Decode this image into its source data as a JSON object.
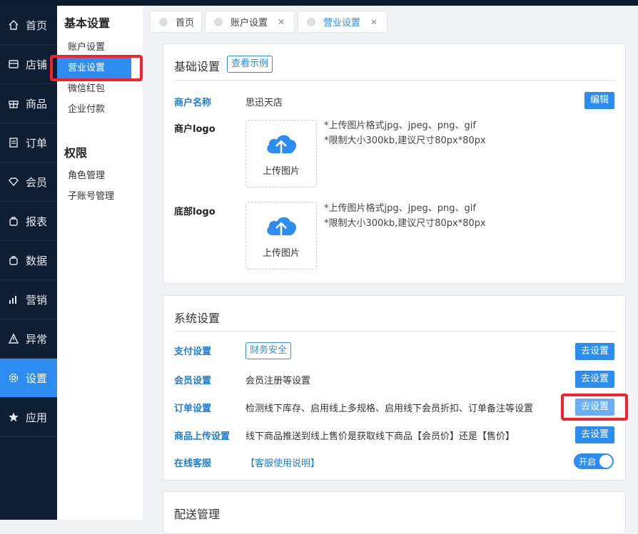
{
  "nav": {
    "items": [
      {
        "label": "首页",
        "icon": "home-icon"
      },
      {
        "label": "店铺",
        "icon": "store-icon"
      },
      {
        "label": "商品",
        "icon": "gift-icon"
      },
      {
        "label": "订单",
        "icon": "order-icon"
      },
      {
        "label": "会员",
        "icon": "diamond-icon"
      },
      {
        "label": "报表",
        "icon": "bag-icon"
      },
      {
        "label": "数据",
        "icon": "bag-icon"
      },
      {
        "label": "营销",
        "icon": "bar-chart-icon"
      },
      {
        "label": "异常",
        "icon": "warning-icon"
      },
      {
        "label": "设置",
        "icon": "gear-icon"
      },
      {
        "label": "应用",
        "icon": "star-icon"
      }
    ],
    "active_index": 9
  },
  "subnav": {
    "group1_title": "基本设置",
    "group1_items": [
      "账户设置",
      "营业设置",
      "微信红包",
      "企业付款"
    ],
    "group2_title": "权限",
    "group2_items": [
      "角色管理",
      "子账号管理"
    ],
    "active_item": "营业设置"
  },
  "tabs": [
    {
      "label": "首页"
    },
    {
      "label": "账户设置",
      "close": "✕"
    },
    {
      "label": "营业设置",
      "close": "✕"
    }
  ],
  "basic": {
    "title": "基础设置",
    "example_link": "查看示例",
    "merchant_name_label": "商户名称",
    "merchant_name_value": "思迅天店",
    "edit_button": "编辑",
    "logo_label": "商户logo",
    "bottom_logo_label": "底部logo",
    "upload_text": "上传图片",
    "hint_line1": "*上传图片格式jpg、jpeg、png、gif",
    "hint_line2": "*限制大小300kb,建议尺寸80px*80px"
  },
  "system": {
    "title": "系统设置",
    "rows": [
      {
        "label": "支付设置",
        "value": "财务安全",
        "button": "去设置"
      },
      {
        "label": "会员设置",
        "value": "会员注册等设置",
        "button": "去设置"
      },
      {
        "label": "订单设置",
        "value": "检测线下库存、启用线上多规格、启用线下会员折扣、订单备注等设置",
        "button": "去设置"
      },
      {
        "label": "商品上传设置",
        "value": "线下商品推送到线上售价是获取线下商品【会员价】还是【售价】",
        "button": "去设置"
      },
      {
        "label": "在线客服",
        "value": "【客服使用说明】",
        "toggle": "开启"
      }
    ]
  },
  "delivery": {
    "title": "配送管理"
  },
  "colors": {
    "accent": "#2d8cf0",
    "nav_bg": "#0f1f33",
    "highlight": "#f5222d"
  }
}
